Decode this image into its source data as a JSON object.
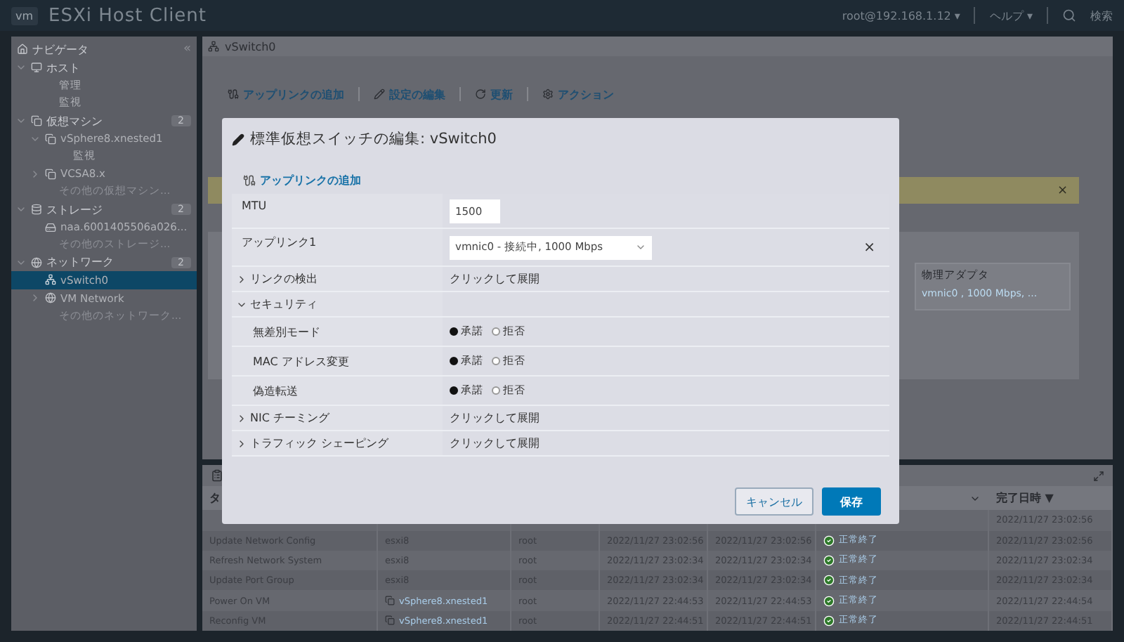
{
  "header": {
    "logo": "vm",
    "title": "ESXi Host Client",
    "user": "root@192.168.1.12 ▾",
    "help": "ヘルプ ▾",
    "search": "検索"
  },
  "navigator": {
    "title": "ナビゲータ",
    "collapse": "«",
    "items": [
      {
        "label": "ホスト",
        "expanded": true,
        "selected": false,
        "children": [
          {
            "label": "管理",
            "selected": false
          },
          {
            "label": "監視",
            "selected": false
          }
        ]
      },
      {
        "label": "仮想マシン",
        "count": "2",
        "expanded": true,
        "selected": false,
        "children": [
          {
            "label": "vSphere8.xnested1",
            "kind": "vm",
            "expanded": true,
            "selected": false,
            "children": [
              {
                "label": "監視",
                "selected": false
              }
            ]
          },
          {
            "label": "VCSA8.x",
            "kind": "vm",
            "expanded": false,
            "selected": false
          },
          {
            "label": "その他の仮想マシン...",
            "kind": "more",
            "selected": false
          }
        ]
      },
      {
        "label": "ストレージ",
        "count": "2",
        "expanded": true,
        "selected": false,
        "children": [
          {
            "label": "naa.6001405506a026...",
            "kind": "disk",
            "selected": false
          },
          {
            "label": "その他のストレージ...",
            "kind": "more",
            "selected": false
          }
        ]
      },
      {
        "label": "ネットワーク",
        "count": "2",
        "expanded": true,
        "selected": false,
        "children": [
          {
            "label": "vSwitch0",
            "kind": "switch",
            "selected": true
          },
          {
            "label": "VM Network",
            "kind": "network",
            "expanded": false,
            "selected": false
          },
          {
            "label": "その他のネットワーク...",
            "kind": "more",
            "selected": false
          }
        ]
      }
    ]
  },
  "main": {
    "tab": "vSwitch0",
    "toolbar": [
      "アップリンクの追加",
      "設定の編集",
      "更新",
      "アクション"
    ],
    "banner": {
      "close": "×"
    },
    "adapter_card": {
      "title": "物理アダプタ",
      "item": "vmnic0 , 1000 Mbps, ..."
    }
  },
  "tasks": {
    "column_headers": {
      "first": "タ",
      "last": "完了日時 ▼"
    },
    "rows": [
      {
        "completed": "2022/11/27 23:02:56"
      },
      {
        "task": "Update Network Config",
        "target": "esxi8",
        "target_is_link": false,
        "initiator": "root",
        "queued": "2022/11/27 23:02:56",
        "started": "2022/11/27 23:02:56",
        "result": "正常終了",
        "completed": "2022/11/27 23:02:56"
      },
      {
        "task": "Refresh Network System",
        "target": "esxi8",
        "target_is_link": false,
        "initiator": "root",
        "queued": "2022/11/27 23:02:34",
        "started": "2022/11/27 23:02:34",
        "result": "正常終了",
        "completed": "2022/11/27 23:02:34"
      },
      {
        "task": "Update Port Group",
        "target": "esxi8",
        "target_is_link": false,
        "initiator": "root",
        "queued": "2022/11/27 23:02:34",
        "started": "2022/11/27 23:02:34",
        "result": "正常終了",
        "completed": "2022/11/27 23:02:34"
      },
      {
        "task": "Power On VM",
        "target": "vSphere8.xnested1",
        "target_is_link": true,
        "initiator": "root",
        "queued": "2022/11/27 22:44:53",
        "started": "2022/11/27 22:44:53",
        "result": "正常終了",
        "completed": "2022/11/27 22:44:54"
      },
      {
        "task": "Reconfig VM",
        "target": "vSphere8.xnested1",
        "target_is_link": true,
        "initiator": "root",
        "queued": "2022/11/27 22:44:51",
        "started": "2022/11/27 22:44:51",
        "result": "正常終了",
        "completed": "2022/11/27 22:44:51"
      }
    ]
  },
  "dialog": {
    "title": "標準仮想スイッチの編集: vSwitch0",
    "add_uplink": "アップリンクの追加",
    "rows": [
      {
        "kind": "input",
        "label": "MTU",
        "value": "1500"
      },
      {
        "kind": "select",
        "label": "アップリンク1",
        "value": "vmnic0 - 接続中, 1000 Mbps",
        "remove": "×"
      },
      {
        "kind": "section",
        "label": "リンクの検出",
        "expanded": false,
        "value": "クリックして展開"
      },
      {
        "kind": "section",
        "label": "セキュリティ",
        "expanded": true
      },
      {
        "kind": "radio",
        "label": "無差別モード",
        "options": [
          {
            "label": "承諾",
            "selected": true
          },
          {
            "label": "拒否",
            "selected": false
          }
        ]
      },
      {
        "kind": "radio",
        "label": "MAC アドレス変更",
        "options": [
          {
            "label": "承諾",
            "selected": true
          },
          {
            "label": "拒否",
            "selected": false
          }
        ]
      },
      {
        "kind": "radio",
        "label": "偽造転送",
        "options": [
          {
            "label": "承諾",
            "selected": true
          },
          {
            "label": "拒否",
            "selected": false
          }
        ]
      },
      {
        "kind": "section",
        "label": "NIC チーミング",
        "expanded": false,
        "value": "クリックして展開"
      },
      {
        "kind": "section",
        "label": "トラフィック シェーピング",
        "expanded": false,
        "value": "クリックして展開"
      }
    ],
    "buttons": [
      {
        "label": "キャンセル",
        "kind": "secondary"
      },
      {
        "label": "保存",
        "kind": "primary"
      }
    ]
  }
}
